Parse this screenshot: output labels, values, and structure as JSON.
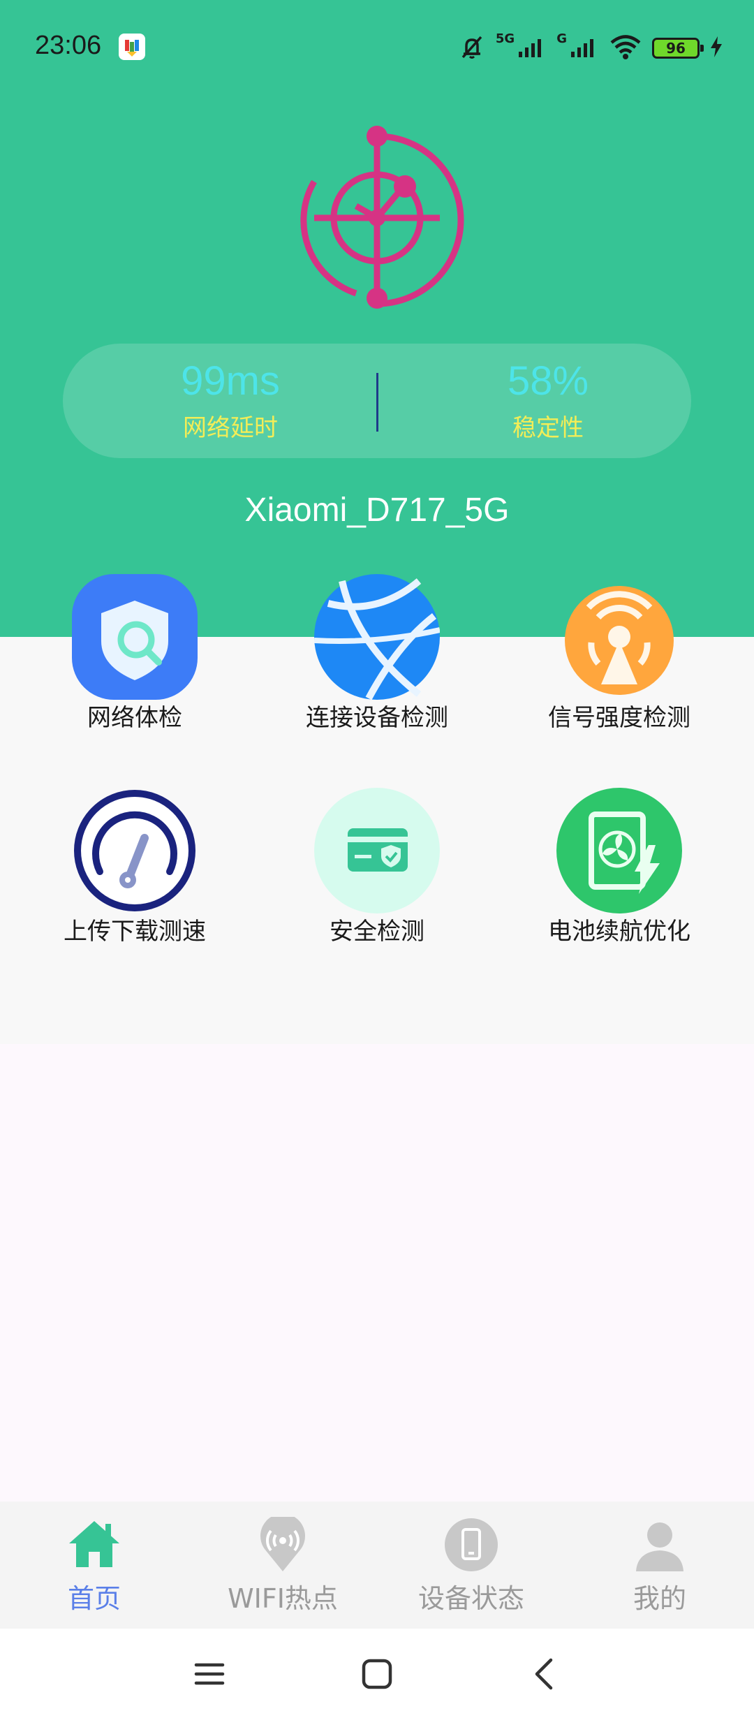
{
  "status_bar": {
    "time": "23:06",
    "network_5g": "5G",
    "network_g": "G",
    "battery_level": "96"
  },
  "stats": {
    "latency_value": "99ms",
    "latency_label": "网络延时",
    "stability_value": "58%",
    "stability_label": "稳定性"
  },
  "wifi_name": "Xiaomi_D717_5G",
  "tools": [
    {
      "label": "网络体检",
      "icon": "shield-search-icon"
    },
    {
      "label": "连接设备检测",
      "icon": "globe-network-icon"
    },
    {
      "label": "信号强度检测",
      "icon": "signal-tower-icon"
    },
    {
      "label": "上传下载测速",
      "icon": "speedometer-icon"
    },
    {
      "label": "安全检测",
      "icon": "secure-card-icon"
    },
    {
      "label": "电池续航优化",
      "icon": "battery-fan-icon"
    }
  ],
  "bottom_nav": [
    {
      "label": "首页",
      "icon": "home-icon",
      "active": true
    },
    {
      "label": "WIFI热点",
      "icon": "wifi-hotspot-icon",
      "active": false
    },
    {
      "label": "设备状态",
      "icon": "device-icon",
      "active": false
    },
    {
      "label": "我的",
      "icon": "profile-icon",
      "active": false
    }
  ],
  "colors": {
    "header_bg": "#36c495",
    "accent_pink": "#d63384",
    "stat_value": "#4de4e9",
    "stat_label": "#f3ed57",
    "nav_active": "#5a7fe8",
    "nav_inactive": "#9a9a9a"
  }
}
